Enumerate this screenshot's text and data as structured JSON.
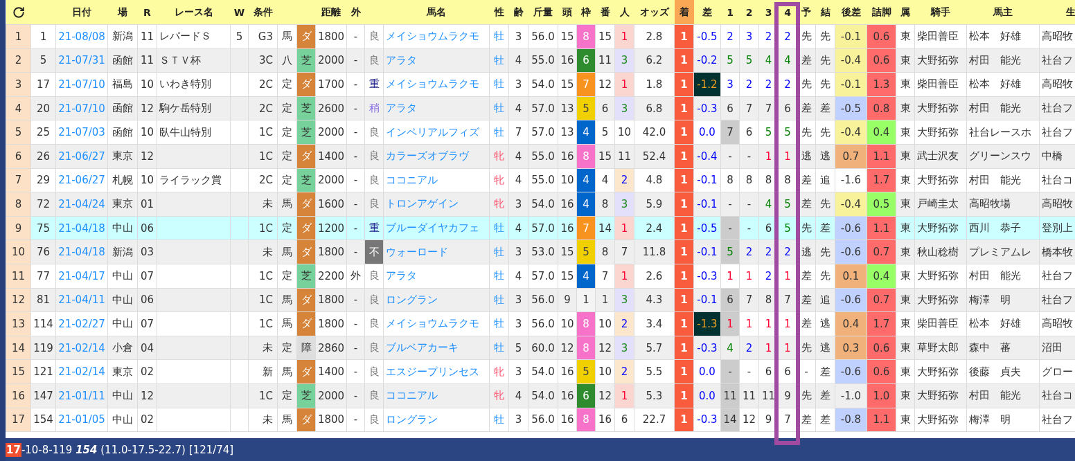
{
  "columns": [
    {
      "kind": "reload",
      "highlighted": false
    },
    {
      "highlighted": false
    },
    {
      "label": "日付",
      "highlighted": false
    },
    {
      "label": "場",
      "highlighted": false
    },
    {
      "label": "R",
      "highlighted": false
    },
    {
      "label": "レース名",
      "highlighted": false
    },
    {
      "label": "W",
      "highlighted": false
    },
    {
      "label": "条件",
      "highlighted": false
    },
    {
      "highlighted": false
    },
    {
      "highlighted": false
    },
    {
      "label": "距離",
      "highlighted": false
    },
    {
      "label": "外",
      "highlighted": false
    },
    {
      "highlighted": false
    },
    {
      "label": "馬名",
      "highlighted": false
    },
    {
      "label": "性",
      "highlighted": false
    },
    {
      "label": "齢",
      "highlighted": false
    },
    {
      "label": "斤量",
      "highlighted": false
    },
    {
      "label": "頭",
      "highlighted": false
    },
    {
      "label": "枠",
      "highlighted": false
    },
    {
      "label": "番",
      "highlighted": false
    },
    {
      "label": "人",
      "highlighted": false
    },
    {
      "label": "オッズ",
      "highlighted": false
    },
    {
      "label": "着",
      "highlighted": false
    },
    {
      "label": "差",
      "highlighted": false
    },
    {
      "label": "1",
      "highlighted": false
    },
    {
      "label": "2",
      "highlighted": false
    },
    {
      "label": "3",
      "highlighted": false
    },
    {
      "label": "4",
      "highlighted": true
    },
    {
      "label": "予",
      "highlighted": false
    },
    {
      "label": "結",
      "highlighted": false
    },
    {
      "label": "後差",
      "highlighted": false
    },
    {
      "label": "詰脚",
      "highlighted": false
    },
    {
      "label": "属",
      "highlighted": false
    },
    {
      "label": "騎手",
      "highlighted": false
    },
    {
      "label": "馬主",
      "highlighted": false
    },
    {
      "label": "生",
      "highlighted": false
    }
  ],
  "rows": [
    {
      "no": "1",
      "id": "1",
      "date": "21-08/08",
      "venue": "新潟",
      "r": "11",
      "race": "レパードＳ",
      "w": "5",
      "class": "G3",
      "cond": "馬",
      "surface": {
        "text": "ダ",
        "kind": "dirt"
      },
      "dist": "1800",
      "outer": "-",
      "going": {
        "text": "良",
        "kind": "good"
      },
      "horse": "メイショウムラクモ",
      "sex": {
        "text": "牡",
        "kind": "male"
      },
      "age": "3",
      "weight": "56.0",
      "heads": "15",
      "waku": {
        "text": "8",
        "color": "#f772c9"
      },
      "umaban": "15",
      "pop": {
        "text": "1",
        "kind": "first"
      },
      "odds": "2.8",
      "finish": "1",
      "margin": {
        "text": "-0.5",
        "dark": false
      },
      "corner_shaded": false,
      "corners": [
        {
          "text": "2",
          "color": "#0000ff"
        },
        {
          "text": "3",
          "color": "#0000ff"
        },
        {
          "text": "2",
          "color": "#0000ff"
        },
        {
          "text": "2",
          "color": "#0000ff"
        }
      ],
      "pace": "先",
      "result": "先",
      "late": {
        "text": "-0.1",
        "color": "#f8f39a"
      },
      "closing": {
        "text": "0.6",
        "color": "#ff6b6b"
      },
      "stable": "東",
      "jockey": "柴田善臣",
      "owner": "松本　好雄",
      "breeder": "高昭牧",
      "selected": false
    },
    {
      "no": "2",
      "id": "5",
      "date": "21-07/31",
      "venue": "函館",
      "r": "11",
      "race": "ＳＴＶ杯",
      "class": "3C",
      "cond": "八",
      "surface": {
        "text": "芝",
        "kind": "turf"
      },
      "dist": "2000",
      "outer": "-",
      "going": {
        "text": "良",
        "kind": "good"
      },
      "horse": "アラタ",
      "sex": {
        "text": "牡",
        "kind": "male"
      },
      "age": "4",
      "weight": "55.0",
      "heads": "16",
      "waku": {
        "text": "6",
        "color": "#2e8b2e"
      },
      "umaban": "11",
      "pop": {
        "text": "3",
        "kind": "third"
      },
      "odds": "6.2",
      "finish": "1",
      "margin": {
        "text": "-0.2",
        "dark": false
      },
      "corner_shaded": false,
      "corners": [
        {
          "text": "5",
          "color": "#008000"
        },
        {
          "text": "5",
          "color": "#008000"
        },
        {
          "text": "4",
          "color": "#008000"
        },
        {
          "text": "4",
          "color": "#008000"
        }
      ],
      "pace": "差",
      "result": "先",
      "late": {
        "text": "-0.4",
        "color": "#f8f39a"
      },
      "closing": {
        "text": "0.6",
        "color": "#ff6b6b"
      },
      "stable": "東",
      "jockey": "大野拓弥",
      "owner": "村田　能光",
      "breeder": "社台フ",
      "selected": false
    },
    {
      "no": "3",
      "id": "17",
      "date": "21-07/10",
      "venue": "福島",
      "r": "10",
      "race": "いわき特別",
      "class": "2C",
      "cond": "定",
      "surface": {
        "text": "ダ",
        "kind": "dirt"
      },
      "dist": "1700",
      "outer": "-",
      "going": {
        "text": "重",
        "kind": "heavy"
      },
      "horse": "メイショウムラクモ",
      "sex": {
        "text": "牡",
        "kind": "male"
      },
      "age": "3",
      "weight": "54.0",
      "heads": "15",
      "waku": {
        "text": "7",
        "color": "#f7931e"
      },
      "umaban": "12",
      "pop": {
        "text": "1",
        "kind": "first"
      },
      "odds": "1.8",
      "finish": "1",
      "margin": {
        "text": "-1.2",
        "dark": true
      },
      "corner_shaded": false,
      "corners": [
        {
          "text": "3",
          "color": "#0000ff"
        },
        {
          "text": "2",
          "color": "#0000ff"
        },
        {
          "text": "2",
          "color": "#0000ff"
        },
        {
          "text": "2",
          "color": "#0000ff"
        }
      ],
      "pace": "先",
      "result": "先",
      "late": {
        "text": "-0.1",
        "color": "#f8f39a"
      },
      "closing": {
        "text": "1.3",
        "color": "#ff6b6b"
      },
      "stable": "東",
      "jockey": "柴田善臣",
      "owner": "松本　好雄",
      "breeder": "高昭牧",
      "selected": false
    },
    {
      "no": "4",
      "id": "20",
      "date": "21-07/10",
      "venue": "函館",
      "r": "12",
      "race": "駒ケ岳特別",
      "class": "2C",
      "cond": "定",
      "surface": {
        "text": "芝",
        "kind": "turf"
      },
      "dist": "2600",
      "outer": "-",
      "going": {
        "text": "稍",
        "kind": "slightly"
      },
      "horse": "アラタ",
      "sex": {
        "text": "牡",
        "kind": "male"
      },
      "age": "4",
      "weight": "57.0",
      "heads": "13",
      "waku": {
        "text": "5",
        "color": "#f0d000"
      },
      "umaban": "6",
      "pop": {
        "text": "3",
        "kind": "third"
      },
      "odds": "6.8",
      "finish": "1",
      "margin": {
        "text": "-0.3",
        "dark": false
      },
      "corner_shaded": false,
      "corners": [
        {
          "text": "6",
          "color": "#333333"
        },
        {
          "text": "7",
          "color": "#333333"
        },
        {
          "text": "7",
          "color": "#333333"
        },
        {
          "text": "6",
          "color": "#333333"
        }
      ],
      "pace": "差",
      "result": "差",
      "late": {
        "text": "-0.5",
        "color": "#c0d0ff"
      },
      "closing": {
        "text": "0.8",
        "color": "#ff6b6b"
      },
      "stable": "東",
      "jockey": "大野拓弥",
      "owner": "村田　能光",
      "breeder": "社台フ",
      "selected": false
    },
    {
      "no": "5",
      "id": "25",
      "date": "21-07/03",
      "venue": "函館",
      "r": "10",
      "race": "臥牛山特別",
      "class": "1C",
      "cond": "定",
      "surface": {
        "text": "芝",
        "kind": "turf"
      },
      "dist": "2000",
      "outer": "-",
      "going": {
        "text": "良",
        "kind": "good"
      },
      "horse": "インペリアルフィズ",
      "sex": {
        "text": "牡",
        "kind": "male"
      },
      "age": "7",
      "weight": "57.0",
      "heads": "13",
      "waku": {
        "text": "4",
        "color": "#0066cc"
      },
      "umaban": "5",
      "pop": {
        "text": "10",
        "kind": "plain"
      },
      "odds": "42.0",
      "finish": "1",
      "margin": {
        "text": "0.0",
        "dark": false
      },
      "corner_shaded": true,
      "corners": [
        {
          "text": "7",
          "color": "#333333"
        },
        {
          "text": "6",
          "color": "#333333"
        },
        {
          "text": "5",
          "color": "#008000"
        },
        {
          "text": "5",
          "color": "#008000"
        }
      ],
      "pace": "先",
      "result": "先",
      "late": {
        "text": "-0.4",
        "color": "#f8f39a"
      },
      "closing": {
        "text": "0.4",
        "color": "#99ff66"
      },
      "stable": "東",
      "jockey": "大野拓弥",
      "owner": "社台レースホ",
      "breeder": "社台フ",
      "selected": false
    },
    {
      "no": "6",
      "id": "26",
      "date": "21-06/27",
      "venue": "東京",
      "r": "12",
      "class": "1C",
      "cond": "定",
      "surface": {
        "text": "ダ",
        "kind": "dirt"
      },
      "dist": "1400",
      "outer": "-",
      "going": {
        "text": "良",
        "kind": "good"
      },
      "horse": "カラーズオブラヴ",
      "sex": {
        "text": "牝",
        "kind": "female"
      },
      "age": "4",
      "weight": "55.0",
      "heads": "16",
      "waku": {
        "text": "8",
        "color": "#f772c9"
      },
      "umaban": "15",
      "pop": {
        "text": "11",
        "kind": "plain"
      },
      "odds": "52.4",
      "finish": "1",
      "margin": {
        "text": "-0.4",
        "dark": false
      },
      "corner_shaded": false,
      "corners": [
        {
          "text": "-",
          "color": "#333333"
        },
        {
          "text": "-",
          "color": "#333333"
        },
        {
          "text": "1",
          "color": "#ff0033"
        },
        {
          "text": "1",
          "color": "#ff0033"
        }
      ],
      "pace": "逃",
      "result": "逃",
      "late": {
        "text": "0.7",
        "color": "#f0b27a"
      },
      "closing": {
        "text": "1.1",
        "color": "#ff6b6b"
      },
      "stable": "東",
      "jockey": "武士沢友",
      "owner": "グリーンスウ",
      "breeder": "中橋",
      "selected": false
    },
    {
      "no": "7",
      "id": "29",
      "date": "21-06/27",
      "venue": "札幌",
      "r": "10",
      "race": "ライラック賞",
      "class": "2C",
      "cond": "定",
      "surface": {
        "text": "芝",
        "kind": "turf"
      },
      "dist": "2000",
      "outer": "-",
      "going": {
        "text": "良",
        "kind": "good"
      },
      "horse": "ココニアル",
      "sex": {
        "text": "牝",
        "kind": "female"
      },
      "age": "4",
      "weight": "55.0",
      "heads": "10",
      "waku": {
        "text": "4",
        "color": "#0066cc"
      },
      "umaban": "4",
      "pop": {
        "text": "2",
        "kind": "second"
      },
      "odds": "4.8",
      "finish": "1",
      "margin": {
        "text": "-0.1",
        "dark": false
      },
      "corner_shaded": false,
      "corners": [
        {
          "text": "8",
          "color": "#333333"
        },
        {
          "text": "8",
          "color": "#333333"
        },
        {
          "text": "8",
          "color": "#333333"
        },
        {
          "text": "8",
          "color": "#333333"
        }
      ],
      "pace": "差",
      "result": "追",
      "late": {
        "text": "-1.6"
      },
      "closing": {
        "text": "1.7",
        "color": "#ff6b6b"
      },
      "stable": "東",
      "jockey": "大野拓弥",
      "owner": "村田　能光",
      "breeder": "社台コ",
      "selected": false
    },
    {
      "no": "8",
      "id": "72",
      "date": "21-04/24",
      "venue": "東京",
      "r": "01",
      "class": "未",
      "cond": "馬",
      "surface": {
        "text": "ダ",
        "kind": "dirt"
      },
      "dist": "1600",
      "outer": "-",
      "going": {
        "text": "良",
        "kind": "good"
      },
      "horse": "トロンアゲイン",
      "sex": {
        "text": "牝",
        "kind": "female"
      },
      "age": "3",
      "weight": "54.0",
      "heads": "16",
      "waku": {
        "text": "4",
        "color": "#0066cc"
      },
      "umaban": "8",
      "pop": {
        "text": "3",
        "kind": "third"
      },
      "odds": "5.9",
      "finish": "1",
      "margin": {
        "text": "-0.1",
        "dark": false
      },
      "corner_shaded": false,
      "corners": [
        {
          "text": "-",
          "color": "#333333"
        },
        {
          "text": "-",
          "color": "#333333"
        },
        {
          "text": "4",
          "color": "#008000"
        },
        {
          "text": "5",
          "color": "#008000"
        }
      ],
      "pace": "差",
      "result": "先",
      "late": {
        "text": "-0.4",
        "color": "#f8f39a"
      },
      "closing": {
        "text": "0.5",
        "color": "#99ff66"
      },
      "stable": "東",
      "jockey": "戸崎圭太",
      "owner": "高昭牧場",
      "breeder": "高昭牧",
      "selected": false
    },
    {
      "no": "9",
      "id": "75",
      "date": "21-04/18",
      "venue": "中山",
      "r": "06",
      "class": "1C",
      "cond": "定",
      "surface": {
        "text": "ダ",
        "kind": "dirt"
      },
      "dist": "1200",
      "outer": "-",
      "going": {
        "text": "重",
        "kind": "heavy"
      },
      "horse": "ブルーダイヤカフェ",
      "sex": {
        "text": "牡",
        "kind": "male"
      },
      "age": "4",
      "weight": "57.0",
      "heads": "16",
      "waku": {
        "text": "7",
        "color": "#f7931e"
      },
      "umaban": "14",
      "pop": {
        "text": "1",
        "kind": "first"
      },
      "odds": "2.4",
      "finish": "1",
      "margin": {
        "text": "-0.5",
        "dark": false
      },
      "corner_shaded": true,
      "corners": [
        {
          "text": "-",
          "color": "#333333"
        },
        {
          "text": "-",
          "color": "#333333"
        },
        {
          "text": "6",
          "color": "#333333"
        },
        {
          "text": "5",
          "color": "#008000"
        }
      ],
      "pace": "先",
      "result": "差",
      "late": {
        "text": "-0.6",
        "color": "#c0d0ff"
      },
      "closing": {
        "text": "1.1",
        "color": "#ff6b6b"
      },
      "stable": "東",
      "jockey": "大野拓弥",
      "owner": "西川　恭子",
      "breeder": "登別上",
      "selected": true
    },
    {
      "no": "10",
      "id": "76",
      "date": "21-04/18",
      "venue": "新潟",
      "r": "03",
      "class": "未",
      "cond": "馬",
      "surface": {
        "text": "ダ",
        "kind": "dirt"
      },
      "dist": "1800",
      "outer": "-",
      "going": {
        "text": "不",
        "kind": "bad"
      },
      "horse": "ウォーロード",
      "sex": {
        "text": "牡",
        "kind": "male"
      },
      "age": "3",
      "weight": "53.0",
      "heads": "15",
      "waku": {
        "text": "5",
        "color": "#f0d000"
      },
      "umaban": "8",
      "pop": {
        "text": "7",
        "kind": "plain"
      },
      "odds": "11.8",
      "finish": "1",
      "margin": {
        "text": "-0.1",
        "dark": false
      },
      "corner_shaded": true,
      "corners": [
        {
          "text": "5",
          "color": "#008000"
        },
        {
          "text": "2",
          "color": "#0000ff"
        },
        {
          "text": "2",
          "color": "#0000ff"
        },
        {
          "text": "2",
          "color": "#0000ff"
        }
      ],
      "pace": "逃",
      "result": "先",
      "late": {
        "text": "-0.6",
        "color": "#c0d0ff"
      },
      "closing": {
        "text": "0.7",
        "color": "#ff6b6b"
      },
      "stable": "東",
      "jockey": "秋山稔樹",
      "owner": "プレミアムレ",
      "breeder": "橋本牧",
      "selected": false
    },
    {
      "no": "11",
      "id": "77",
      "date": "21-04/17",
      "venue": "中山",
      "r": "07",
      "class": "1C",
      "cond": "定",
      "surface": {
        "text": "芝",
        "kind": "turf"
      },
      "dist": "2200",
      "outer": "外",
      "going": {
        "text": "良",
        "kind": "good"
      },
      "horse": "アラタ",
      "sex": {
        "text": "牡",
        "kind": "male"
      },
      "age": "4",
      "weight": "57.0",
      "heads": "15",
      "waku": {
        "text": "4",
        "color": "#0066cc"
      },
      "umaban": "7",
      "pop": {
        "text": "1",
        "kind": "first"
      },
      "odds": "2.6",
      "finish": "1",
      "margin": {
        "text": "-0.3",
        "dark": false
      },
      "corner_shaded": false,
      "corners": [
        {
          "text": "1",
          "color": "#ff0033"
        },
        {
          "text": "1",
          "color": "#ff0033"
        },
        {
          "text": "2",
          "color": "#0000ff"
        },
        {
          "text": "1",
          "color": "#ff0033"
        }
      ],
      "pace": "差",
      "result": "先",
      "late": {
        "text": "0.1",
        "color": "#f0b27a"
      },
      "closing": {
        "text": "0.4",
        "color": "#99ff66"
      },
      "stable": "東",
      "jockey": "大野拓弥",
      "owner": "村田　能光",
      "breeder": "社台フ",
      "selected": false
    },
    {
      "no": "12",
      "id": "81",
      "date": "21-04/11",
      "venue": "中山",
      "r": "06",
      "class": "1C",
      "cond": "馬",
      "surface": {
        "text": "ダ",
        "kind": "dirt"
      },
      "dist": "1800",
      "outer": "-",
      "going": {
        "text": "良",
        "kind": "good"
      },
      "horse": "ロングラン",
      "sex": {
        "text": "牡",
        "kind": "male"
      },
      "age": "3",
      "weight": "56.0",
      "heads": "9",
      "waku": {
        "text": "1",
        "color": "#f4f4f4"
      },
      "umaban": "1",
      "pop": {
        "text": "3",
        "kind": "third"
      },
      "odds": "4.3",
      "finish": "1",
      "margin": {
        "text": "-0.1",
        "dark": false
      },
      "corner_shaded": true,
      "corners": [
        {
          "text": "6",
          "color": "#333333"
        },
        {
          "text": "7",
          "color": "#333333"
        },
        {
          "text": "8",
          "color": "#333333"
        },
        {
          "text": "7",
          "color": "#333333"
        }
      ],
      "pace": "差",
      "result": "追",
      "late": {
        "text": "-0.6",
        "color": "#c0d0ff"
      },
      "closing": {
        "text": "0.7",
        "color": "#ff6b6b"
      },
      "stable": "東",
      "jockey": "大野拓弥",
      "owner": "梅澤　明",
      "breeder": "社台フ",
      "selected": false
    },
    {
      "no": "13",
      "id": "114",
      "date": "21-02/27",
      "venue": "中山",
      "r": "07",
      "class": "1C",
      "cond": "馬",
      "surface": {
        "text": "ダ",
        "kind": "dirt"
      },
      "dist": "1800",
      "outer": "-",
      "going": {
        "text": "良",
        "kind": "good"
      },
      "horse": "メイショウムラクモ",
      "sex": {
        "text": "牡",
        "kind": "male"
      },
      "age": "3",
      "weight": "56.0",
      "heads": "10",
      "waku": {
        "text": "8",
        "color": "#f772c9"
      },
      "umaban": "10",
      "pop": {
        "text": "2",
        "kind": "second"
      },
      "odds": "3.4",
      "finish": "1",
      "margin": {
        "text": "-1.3",
        "dark": true
      },
      "corner_shaded": true,
      "corners": [
        {
          "text": "1",
          "color": "#ff0033"
        },
        {
          "text": "1",
          "color": "#ff0033"
        },
        {
          "text": "1",
          "color": "#ff0033"
        },
        {
          "text": "1",
          "color": "#ff0033"
        }
      ],
      "pace": "差",
      "result": "逃",
      "late": {
        "text": "0.4",
        "color": "#f0b27a"
      },
      "closing": {
        "text": "1.7",
        "color": "#ff6b6b"
      },
      "stable": "東",
      "jockey": "柴田善臣",
      "owner": "松本　好雄",
      "breeder": "高昭牧",
      "selected": false
    },
    {
      "no": "14",
      "id": "119",
      "date": "21-02/14",
      "venue": "小倉",
      "r": "04",
      "class": "未",
      "cond": "定",
      "surface": {
        "text": "障",
        "kind": "jump"
      },
      "dist": "2860",
      "outer": "-",
      "going": {
        "text": "良",
        "kind": "good"
      },
      "horse": "ブルベアカーキ",
      "sex": {
        "text": "牡",
        "kind": "male"
      },
      "age": "5",
      "weight": "60.0",
      "heads": "12",
      "waku": {
        "text": "8",
        "color": "#f772c9"
      },
      "umaban": "12",
      "pop": {
        "text": "3",
        "kind": "third"
      },
      "odds": "5.7",
      "finish": "1",
      "margin": {
        "text": "-0.3",
        "dark": false
      },
      "corner_shaded": false,
      "corners": [
        {
          "text": "4",
          "color": "#008000"
        },
        {
          "text": "2",
          "color": "#0000ff"
        },
        {
          "text": "1",
          "color": "#ff0033"
        },
        {
          "text": "1",
          "color": "#ff0033"
        }
      ],
      "pace": "先",
      "result": "逃",
      "late": {
        "text": "0.3",
        "color": "#f0b27a"
      },
      "closing": {
        "text": "0.6",
        "color": "#ff6b6b"
      },
      "stable": "東",
      "jockey": "草野太郎",
      "owner": "森中　蕃",
      "breeder": "沼田",
      "selected": false
    },
    {
      "no": "15",
      "id": "121",
      "date": "21-02/14",
      "venue": "東京",
      "r": "02",
      "class": "新",
      "cond": "馬",
      "surface": {
        "text": "ダ",
        "kind": "dirt"
      },
      "dist": "1400",
      "outer": "-",
      "going": {
        "text": "良",
        "kind": "good"
      },
      "horse": "エスジープリンセス",
      "sex": {
        "text": "牝",
        "kind": "female"
      },
      "age": "3",
      "weight": "54.0",
      "heads": "16",
      "waku": {
        "text": "5",
        "color": "#f0d000"
      },
      "umaban": "10",
      "pop": {
        "text": "2",
        "kind": "second"
      },
      "odds": "5.5",
      "finish": "1",
      "margin": {
        "text": "0.0",
        "dark": false
      },
      "corner_shaded": true,
      "corners": [
        {
          "text": "-",
          "color": "#333333"
        },
        {
          "text": "-",
          "color": "#333333"
        },
        {
          "text": "6",
          "color": "#333333"
        },
        {
          "text": "6",
          "color": "#333333"
        }
      ],
      "pace": "-",
      "result": "差",
      "late": {
        "text": "-0.6",
        "color": "#c0d0ff"
      },
      "closing": {
        "text": "0.6",
        "color": "#ff6b6b"
      },
      "stable": "東",
      "jockey": "大野拓弥",
      "owner": "後藤　貞夫",
      "breeder": "グロー",
      "selected": false
    },
    {
      "no": "16",
      "id": "147",
      "date": "21-01/11",
      "venue": "中山",
      "r": "12",
      "class": "1C",
      "cond": "定",
      "surface": {
        "text": "芝",
        "kind": "turf"
      },
      "dist": "2000",
      "outer": "-",
      "going": {
        "text": "良",
        "kind": "good"
      },
      "horse": "ココニアル",
      "sex": {
        "text": "牝",
        "kind": "female"
      },
      "age": "4",
      "weight": "54.0",
      "heads": "16",
      "waku": {
        "text": "6",
        "color": "#2e8b2e"
      },
      "umaban": "12",
      "pop": {
        "text": "1",
        "kind": "first"
      },
      "odds": "5.3",
      "finish": "1",
      "margin": {
        "text": "0.0",
        "dark": false
      },
      "corner_shaded": true,
      "corners": [
        {
          "text": "11",
          "color": "#333333"
        },
        {
          "text": "11",
          "color": "#333333"
        },
        {
          "text": "11",
          "color": "#333333"
        },
        {
          "text": "9",
          "color": "#333333"
        }
      ],
      "pace": "先",
      "result": "差",
      "late": {
        "text": "-1.0"
      },
      "closing": {
        "text": "1.0",
        "color": "#ff6b6b"
      },
      "stable": "東",
      "jockey": "大野拓弥",
      "owner": "村田　能光",
      "breeder": "社台コ",
      "selected": false
    },
    {
      "no": "17",
      "id": "154",
      "date": "21-01/05",
      "venue": "中山",
      "r": "02",
      "class": "未",
      "cond": "馬",
      "surface": {
        "text": "ダ",
        "kind": "dirt"
      },
      "dist": "1800",
      "outer": "-",
      "going": {
        "text": "良",
        "kind": "good"
      },
      "horse": "ロングラン",
      "sex": {
        "text": "牡",
        "kind": "male"
      },
      "age": "3",
      "weight": "56.0",
      "heads": "16",
      "waku": {
        "text": "8",
        "color": "#f772c9"
      },
      "umaban": "16",
      "pop": {
        "text": "6",
        "kind": "plain"
      },
      "odds": "22.7",
      "finish": "1",
      "margin": {
        "text": "-0.3",
        "dark": false
      },
      "corner_shaded": true,
      "corners": [
        {
          "text": "14",
          "color": "#333333"
        },
        {
          "text": "12",
          "color": "#333333"
        },
        {
          "text": "9",
          "color": "#333333"
        },
        {
          "text": "7",
          "color": "#333333"
        }
      ],
      "pace": "差",
      "result": "差",
      "late": {
        "text": "-0.8",
        "color": "#c0d0ff"
      },
      "closing": {
        "text": "1.1",
        "color": "#ff6b6b"
      },
      "stable": "東",
      "jockey": "大野拓弥",
      "owner": "梅澤　明",
      "breeder": "社台フ",
      "selected": false
    }
  ],
  "status_bar": {
    "wins": "17",
    "record": "-10-8-119",
    "total": "154",
    "detail": "(11.0-17.5-22.7) [121/74]"
  }
}
